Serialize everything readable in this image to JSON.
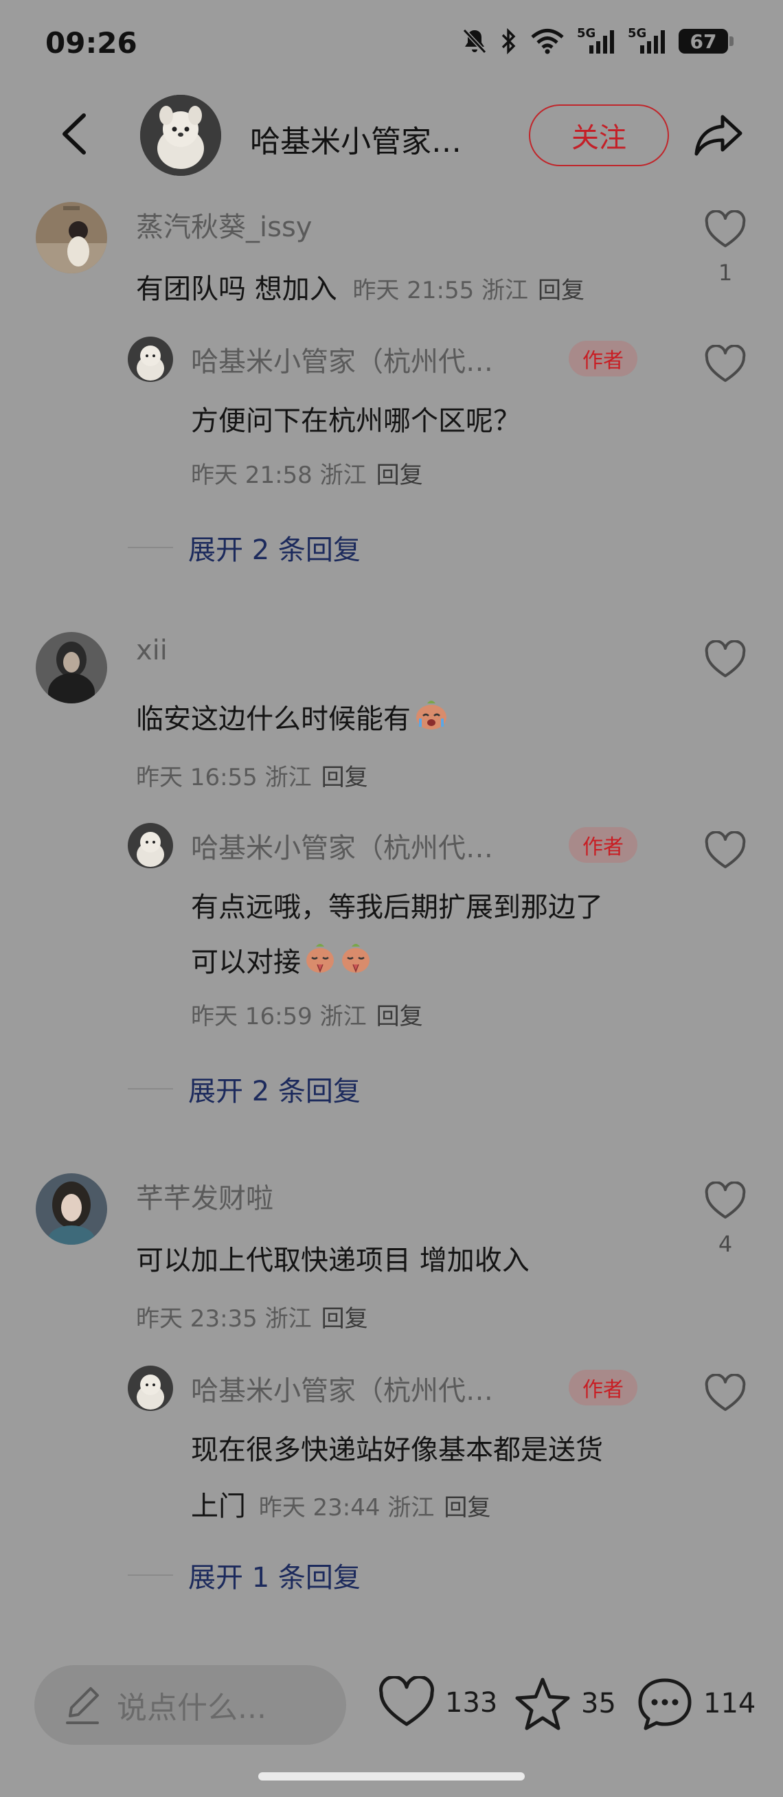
{
  "status_bar": {
    "time": "09:26",
    "battery": "67",
    "net1": "5G",
    "net2": "5G"
  },
  "header": {
    "name": "哈基米小管家…",
    "follow_label": "关注"
  },
  "comments": [
    {
      "user": "蒸汽秋葵_issy",
      "text": "有团队吗 想加入",
      "time": "昨天 21:55",
      "loc": "浙江",
      "reply_label": "回复",
      "likes": "1",
      "replies": [
        {
          "user": "哈基米小管家（杭州代…",
          "badge": "作者",
          "text": "方便问下在杭州哪个区呢？",
          "time": "昨天 21:58",
          "loc": "浙江",
          "reply_label": "回复"
        }
      ],
      "expand_label": "展开 2 条回复"
    },
    {
      "user": "xii",
      "text": "临安这边什么时候能有",
      "time": "昨天 16:55",
      "loc": "浙江",
      "reply_label": "回复",
      "likes": "",
      "replies": [
        {
          "user": "哈基米小管家（杭州代…",
          "badge": "作者",
          "text_line1": "有点远哦，等我后期扩展到那边了",
          "text_line2": "可以对接",
          "time": "昨天 16:59",
          "loc": "浙江",
          "reply_label": "回复"
        }
      ],
      "expand_label": "展开 2 条回复"
    },
    {
      "user": "芊芊发财啦",
      "text": "可以加上代取快递项目 增加收入",
      "time": "昨天 23:35",
      "loc": "浙江",
      "reply_label": "回复",
      "likes": "4",
      "replies": [
        {
          "user": "哈基米小管家（杭州代…",
          "badge": "作者",
          "text_line1": "现在很多快递站好像基本都是送货",
          "text_line2": "上门",
          "time": "昨天 23:44",
          "loc": "浙江",
          "reply_label": "回复"
        }
      ],
      "expand_label": "展开 1 条回复"
    }
  ],
  "bottom_bar": {
    "placeholder": "说点什么...",
    "likes": "133",
    "stars": "35",
    "comments": "114"
  },
  "icons": [
    "back-icon",
    "share-icon",
    "heart-icon",
    "star-icon",
    "comment-icon",
    "pencil-icon",
    "mute-icon",
    "bluetooth-icon",
    "wifi-icon",
    "signal-icon"
  ]
}
